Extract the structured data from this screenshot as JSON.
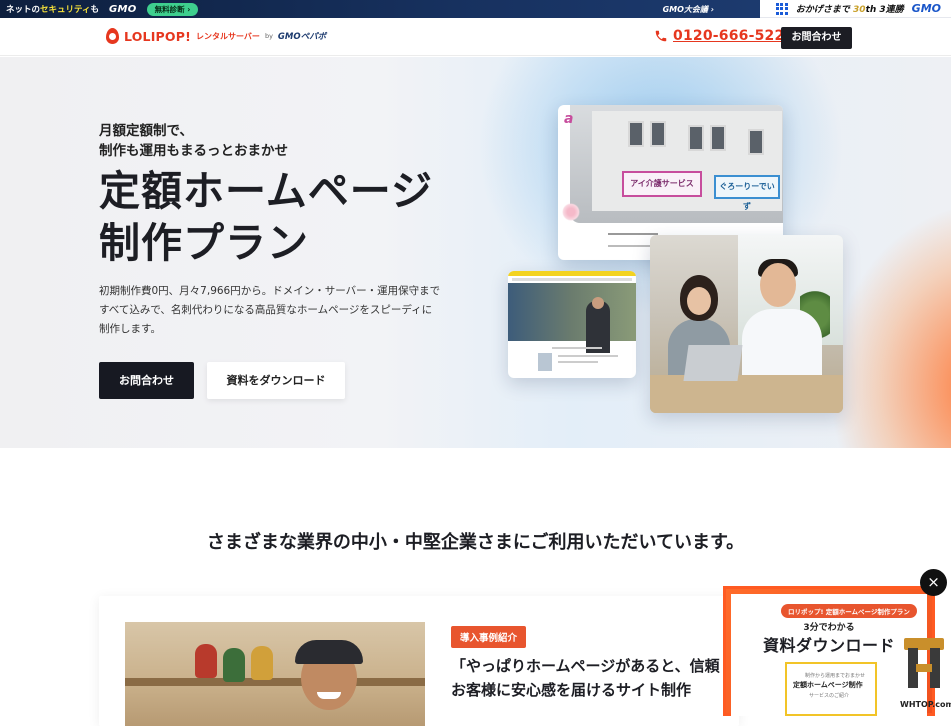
{
  "gmo_bar": {
    "security_prefix": "ネットの",
    "security_highlight": "セキュリティ",
    "security_suffix": "も",
    "gmo_logo": "GMO",
    "diagnosis_label": "無料診断 ›",
    "taikai_label": "GMO大会議 ›",
    "thanks_text": "おかげさまで",
    "thanks_num": "30",
    "thanks_suffix": "th 3連勝",
    "gmo_logo_right": "GMO"
  },
  "header": {
    "brand_name": "LOLIPOP!",
    "brand_sub": "レンタルサーバー",
    "brand_by": "by",
    "brand_pepabo": "GMOペパボ",
    "phone_number": "0120-666-522",
    "contact_label": "お問合わせ"
  },
  "hero": {
    "lead_line1": "月額定額制で、",
    "lead_line2": "制作も運用もまるっとおまかせ",
    "title_line1": "定額ホームページ",
    "title_line2": "制作プラン",
    "desc_line1": "初期制作費0円、月々7,966円から。ドメイン・サーバー・運用保守まで",
    "desc_line2": "すべて込みで、名刺代わりになる高品質なホームページをスピーディに",
    "desc_line3": "制作します。",
    "contact_button": "お問合わせ",
    "download_button": "資料をダウンロード",
    "mock_sign_a": "アイ介護サービス",
    "mock_sign_b": "ぐろーりーでいず"
  },
  "industries": {
    "title": "さまざまな業界の中小・中堅企業さまにご利用いただいています。",
    "case_tag": "導入事例紹介",
    "case_title_line1": "「やっぱりホームページがあると、信頼",
    "case_title_line2": "お客様に安心感を届けるサイト制作"
  },
  "popup": {
    "badge": "ロリポップ! 定額ホームページ制作プラン",
    "sub": "3分でわかる",
    "main": "資料ダウンロード",
    "doc_line1": "制作から運用までおまかせ",
    "doc_line2": "定額ホームページ制作",
    "doc_line3": "サービスのご紹介",
    "close_label": "×"
  },
  "watermark": {
    "text": "WHTOP.com"
  },
  "colors": {
    "accent": "#e6371f",
    "dark": "#1c1d24",
    "orange": "#e8552e",
    "gmo_blue": "#1a56c9"
  }
}
